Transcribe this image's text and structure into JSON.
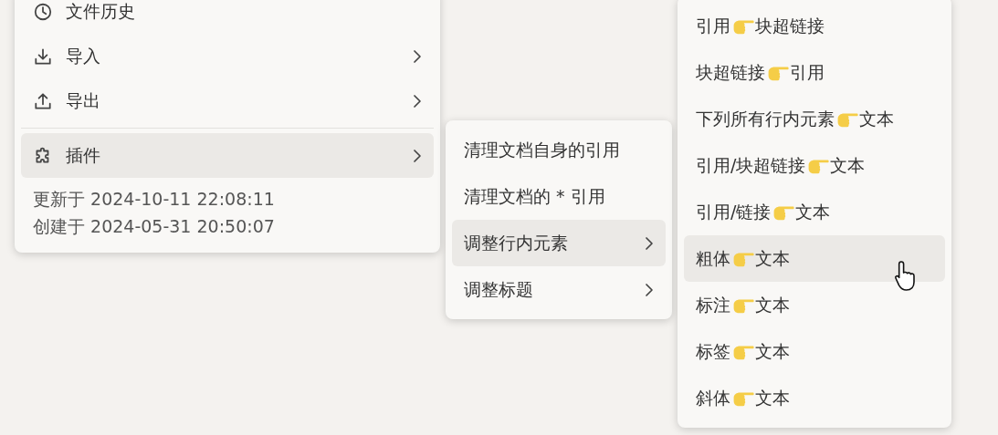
{
  "main_menu": {
    "groups": [
      [
        {
          "label": "文件历史",
          "kind": "clock",
          "submenu": false,
          "selected": false
        },
        {
          "label": "导入",
          "kind": "download",
          "submenu": true,
          "selected": false
        },
        {
          "label": "导出",
          "kind": "upload",
          "submenu": true,
          "selected": false
        }
      ],
      [
        {
          "label": "插件",
          "kind": "puzzle",
          "submenu": true,
          "selected": true
        }
      ]
    ],
    "footer": [
      "更新于 2024-10-11 22:08:11",
      "创建于 2024-05-31 20:50:07"
    ]
  },
  "plugin_menu": {
    "items": [
      {
        "label": "清理文档自身的引用",
        "submenu": false,
        "selected": false
      },
      {
        "label": "清理文档的 * 引用",
        "submenu": false,
        "selected": false
      },
      {
        "label": "调整行内元素",
        "submenu": true,
        "selected": true
      },
      {
        "label": "调整标题",
        "submenu": true,
        "selected": false
      }
    ]
  },
  "inline_menu": {
    "items": [
      {
        "from": "引用",
        "to": "块超链接",
        "selected": false
      },
      {
        "from": "块超链接",
        "to": "引用",
        "selected": false
      },
      {
        "from": "下列所有行内元素",
        "to": "文本",
        "selected": false
      },
      {
        "from": "引用/块超链接",
        "to": "文本",
        "selected": false
      },
      {
        "from": "引用/链接",
        "to": "文本",
        "selected": false
      },
      {
        "from": "粗体",
        "to": "文本",
        "selected": true
      },
      {
        "from": "标注",
        "to": "文本",
        "selected": false
      },
      {
        "from": "标签",
        "to": "文本",
        "selected": false
      },
      {
        "from": "斜体",
        "to": "文本",
        "selected": false
      }
    ]
  }
}
